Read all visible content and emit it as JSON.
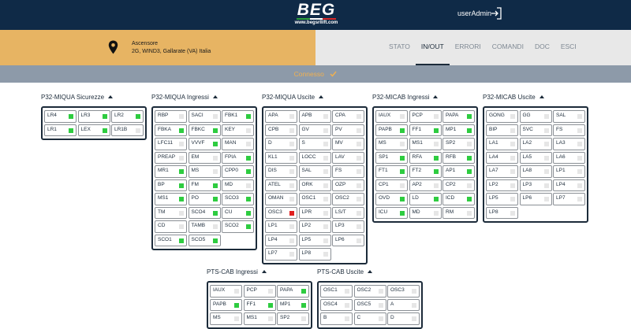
{
  "header": {
    "logo_text": "BEG",
    "logo_url": "www.begsrllift.com",
    "user": "userAdmin",
    "flag_colors": [
      "#2a9d3a",
      "#ffffff",
      "#d62828"
    ]
  },
  "site": {
    "name": "Ascensore",
    "address": "2G, WIND3, Gallarate (VA) Italia"
  },
  "nav": [
    {
      "label": "STATO",
      "active": false
    },
    {
      "label": "IN/OUT",
      "active": true
    },
    {
      "label": "ERRORI",
      "active": false
    },
    {
      "label": "COMANDI",
      "active": false
    },
    {
      "label": "DOC",
      "active": false
    },
    {
      "label": "ESCI",
      "active": false
    }
  ],
  "connection": {
    "status": "Connesso",
    "icon": "check-icon"
  },
  "colors": {
    "on": "#2ecc40",
    "off": "#e6e6e6",
    "alarm": "#e02020",
    "navy": "#0f2a47",
    "accent": "#e7b463"
  },
  "groups": [
    {
      "title": "P32-MIQUA Sicurezze",
      "cells": [
        {
          "label": "LR4",
          "state": "on"
        },
        {
          "label": "LR3",
          "state": "on"
        },
        {
          "label": "LR2",
          "state": "on"
        },
        {
          "label": "LR1",
          "state": "on"
        },
        {
          "label": "LEX",
          "state": "on"
        },
        {
          "label": "LR1B",
          "state": "off"
        }
      ]
    },
    {
      "title": "P32-MIQUA Ingressi",
      "cells": [
        {
          "label": "RBP",
          "state": "off"
        },
        {
          "label": "SACI",
          "state": "off"
        },
        {
          "label": "FBK1",
          "state": "on"
        },
        {
          "label": "FBKA",
          "state": "on"
        },
        {
          "label": "FBKC",
          "state": "on"
        },
        {
          "label": "KEY",
          "state": "off"
        },
        {
          "label": "LFC11",
          "state": "off"
        },
        {
          "label": "VVVF",
          "state": "on"
        },
        {
          "label": "MAN",
          "state": "off"
        },
        {
          "label": "PREAP",
          "state": "off"
        },
        {
          "label": "EM",
          "state": "off"
        },
        {
          "label": "FPIA",
          "state": "on"
        },
        {
          "label": "MR1",
          "state": "on"
        },
        {
          "label": "MS",
          "state": "off"
        },
        {
          "label": "CPP0",
          "state": "on"
        },
        {
          "label": "BP",
          "state": "on"
        },
        {
          "label": "FM",
          "state": "on"
        },
        {
          "label": "MD",
          "state": "off"
        },
        {
          "label": "MS1",
          "state": "on"
        },
        {
          "label": "PO",
          "state": "on"
        },
        {
          "label": "SCO3",
          "state": "on"
        },
        {
          "label": "TM",
          "state": "off"
        },
        {
          "label": "SCO4",
          "state": "on"
        },
        {
          "label": "CU",
          "state": "on"
        },
        {
          "label": "CD",
          "state": "off"
        },
        {
          "label": "TAMB",
          "state": "off"
        },
        {
          "label": "SCO2",
          "state": "on"
        },
        {
          "label": "SCO1",
          "state": "on"
        },
        {
          "label": "SCO5",
          "state": "on"
        }
      ]
    },
    {
      "title": "P32-MIQUA Uscite",
      "cells": [
        {
          "label": "APA",
          "state": "off"
        },
        {
          "label": "APB",
          "state": "off"
        },
        {
          "label": "CPA",
          "state": "off"
        },
        {
          "label": "CPB",
          "state": "off"
        },
        {
          "label": "GV",
          "state": "off"
        },
        {
          "label": "PV",
          "state": "off"
        },
        {
          "label": "D",
          "state": "off"
        },
        {
          "label": "S",
          "state": "off"
        },
        {
          "label": "MV",
          "state": "off"
        },
        {
          "label": "KL1",
          "state": "off"
        },
        {
          "label": "LOCC",
          "state": "off"
        },
        {
          "label": "LAV",
          "state": "off"
        },
        {
          "label": "DIS",
          "state": "off"
        },
        {
          "label": "SAL",
          "state": "off"
        },
        {
          "label": "FS",
          "state": "off"
        },
        {
          "label": "ATEL",
          "state": "off"
        },
        {
          "label": "ORK",
          "state": "off"
        },
        {
          "label": "OZP",
          "state": "off"
        },
        {
          "label": "OMAN",
          "state": "off"
        },
        {
          "label": "OSC1",
          "state": "off"
        },
        {
          "label": "OSC2",
          "state": "off"
        },
        {
          "label": "OSC3",
          "state": "alarm"
        },
        {
          "label": "LPR",
          "state": "off"
        },
        {
          "label": "LS/T",
          "state": "off"
        },
        {
          "label": "LP1",
          "state": "off"
        },
        {
          "label": "LP2",
          "state": "off"
        },
        {
          "label": "LP3",
          "state": "off"
        },
        {
          "label": "LP4",
          "state": "off"
        },
        {
          "label": "LP5",
          "state": "off"
        },
        {
          "label": "LP6",
          "state": "off"
        },
        {
          "label": "LP7",
          "state": "off"
        },
        {
          "label": "LP8",
          "state": "off"
        }
      ]
    },
    {
      "title": "P32-MICAB Ingressi",
      "cells": [
        {
          "label": "IAUX",
          "state": "off"
        },
        {
          "label": "PCP",
          "state": "off"
        },
        {
          "label": "PAPA",
          "state": "on"
        },
        {
          "label": "PAPB",
          "state": "on"
        },
        {
          "label": "FF1",
          "state": "on"
        },
        {
          "label": "MP1",
          "state": "on"
        },
        {
          "label": "MS",
          "state": "off"
        },
        {
          "label": "MS1",
          "state": "off"
        },
        {
          "label": "SP2",
          "state": "off"
        },
        {
          "label": "SP1",
          "state": "on"
        },
        {
          "label": "RFA",
          "state": "on"
        },
        {
          "label": "RFB",
          "state": "on"
        },
        {
          "label": "FT1",
          "state": "on"
        },
        {
          "label": "FT2",
          "state": "on"
        },
        {
          "label": "AP1",
          "state": "on"
        },
        {
          "label": "CP1",
          "state": "off"
        },
        {
          "label": "AP2",
          "state": "off"
        },
        {
          "label": "CP2",
          "state": "off"
        },
        {
          "label": "OVD",
          "state": "on"
        },
        {
          "label": "LD",
          "state": "on"
        },
        {
          "label": "ICD",
          "state": "on"
        },
        {
          "label": "ICU",
          "state": "on"
        },
        {
          "label": "MD",
          "state": "off"
        },
        {
          "label": "RM",
          "state": "off"
        }
      ]
    },
    {
      "title": "P32-MICAB Uscite",
      "cells": [
        {
          "label": "GONG",
          "state": "off"
        },
        {
          "label": "GG",
          "state": "off"
        },
        {
          "label": "SAL",
          "state": "off"
        },
        {
          "label": "BIP",
          "state": "off"
        },
        {
          "label": "SVC",
          "state": "off"
        },
        {
          "label": "FS",
          "state": "off"
        },
        {
          "label": "LA1",
          "state": "off"
        },
        {
          "label": "LA2",
          "state": "off"
        },
        {
          "label": "LA3",
          "state": "off"
        },
        {
          "label": "LA4",
          "state": "off"
        },
        {
          "label": "LA5",
          "state": "off"
        },
        {
          "label": "LA6",
          "state": "off"
        },
        {
          "label": "LA7",
          "state": "off"
        },
        {
          "label": "LA8",
          "state": "off"
        },
        {
          "label": "LP1",
          "state": "off"
        },
        {
          "label": "LP2",
          "state": "off"
        },
        {
          "label": "LP3",
          "state": "off"
        },
        {
          "label": "LP4",
          "state": "off"
        },
        {
          "label": "LP5",
          "state": "off"
        },
        {
          "label": "LP6",
          "state": "off"
        },
        {
          "label": "LP7",
          "state": "off"
        },
        {
          "label": "LP8",
          "state": "off"
        }
      ]
    },
    {
      "title": "PTS-CAB Ingressi",
      "cells": [
        {
          "label": "IAUX",
          "state": "off"
        },
        {
          "label": "PCP",
          "state": "off"
        },
        {
          "label": "PAPA",
          "state": "on"
        },
        {
          "label": "PAPB",
          "state": "on"
        },
        {
          "label": "FF1",
          "state": "on"
        },
        {
          "label": "MP1",
          "state": "on"
        },
        {
          "label": "MS",
          "state": "off"
        },
        {
          "label": "MS1",
          "state": "off"
        },
        {
          "label": "SP2",
          "state": "off"
        }
      ]
    },
    {
      "title": "PTS-CAB Uscite",
      "cells": [
        {
          "label": "OSC1",
          "state": "off"
        },
        {
          "label": "OSC2",
          "state": "off"
        },
        {
          "label": "OSC3",
          "state": "off"
        },
        {
          "label": "OSC4",
          "state": "off"
        },
        {
          "label": "OSC5",
          "state": "off"
        },
        {
          "label": "A",
          "state": "off"
        },
        {
          "label": "B",
          "state": "off"
        },
        {
          "label": "C",
          "state": "off"
        },
        {
          "label": "D",
          "state": "off"
        }
      ]
    }
  ]
}
